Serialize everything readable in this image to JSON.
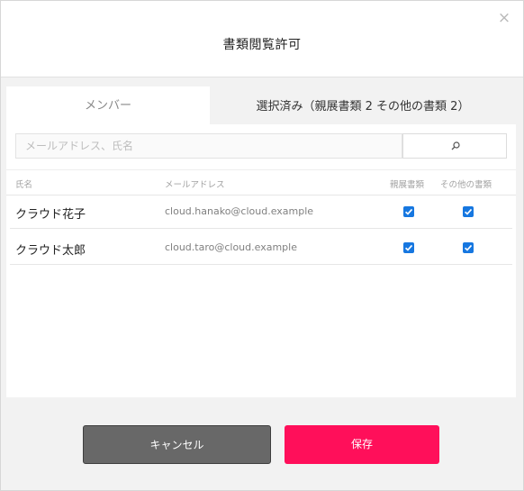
{
  "dialog": {
    "title": "書類閲覧許可",
    "close_icon": "×"
  },
  "tabs": [
    {
      "label": "メンバー",
      "active": true
    },
    {
      "label": "選択済み（親展書類 2  その他の書類 2）",
      "active": false
    }
  ],
  "search": {
    "placeholder": "メールアドレス、氏名",
    "value": ""
  },
  "table": {
    "headers": {
      "name": "氏名",
      "email": "メールアドレス",
      "confidential": "親展書類",
      "other": "その他の書類"
    },
    "rows": [
      {
        "name": "クラウド花子",
        "email": "cloud.hanako@cloud.example",
        "confidential": true,
        "other": true
      },
      {
        "name": "クラウド太郎",
        "email": "cloud.taro@cloud.example",
        "confidential": true,
        "other": true
      }
    ]
  },
  "buttons": {
    "cancel": "キャンセル",
    "save": "保存"
  },
  "colors": {
    "accent": "#ff0f5a",
    "checkbox": "#1677e0",
    "cancel": "#686868"
  }
}
